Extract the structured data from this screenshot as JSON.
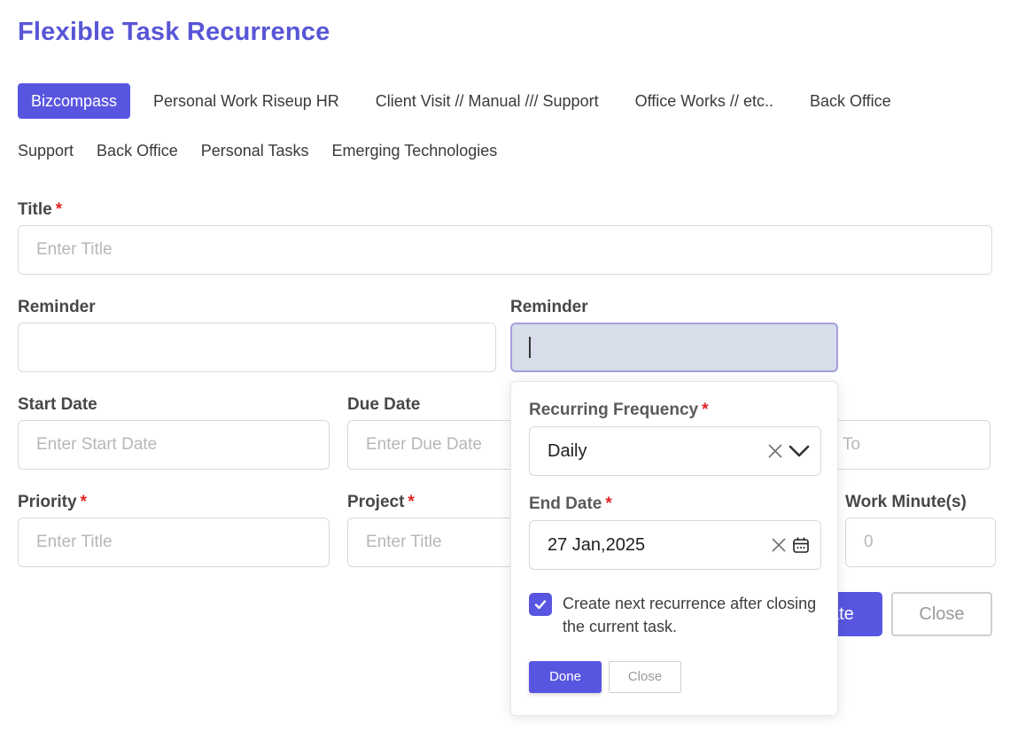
{
  "page": {
    "title": "Flexible Task Recurrence"
  },
  "tabs": {
    "row1": [
      {
        "label": "Bizcompass",
        "active": true
      },
      {
        "label": "Personal Work Riseup HR"
      },
      {
        "label": "Client Visit // Manual /// Support"
      },
      {
        "label": "Office Works // etc.."
      },
      {
        "label": "Back Office"
      }
    ],
    "row2": [
      {
        "label": "Support"
      },
      {
        "label": "Back Office"
      },
      {
        "label": "Personal Tasks"
      },
      {
        "label": "Emerging Technologies"
      }
    ]
  },
  "form": {
    "title": {
      "label": "Title",
      "required": "*",
      "placeholder": "Enter Title",
      "value": ""
    },
    "reminder_left": {
      "label": "Reminder",
      "value": ""
    },
    "reminder_right": {
      "label": "Reminder",
      "value": ""
    },
    "start_date": {
      "label": "Start Date",
      "placeholder": "Enter Start Date"
    },
    "due_date": {
      "label": "Due Date",
      "placeholder": "Enter Due Date"
    },
    "assign_to": {
      "placeholder_visible": "To"
    },
    "priority": {
      "label": "Priority",
      "required": "*",
      "placeholder": "Enter Title"
    },
    "project": {
      "label": "Project",
      "required": "*",
      "placeholder": "Enter Title"
    },
    "work_minutes": {
      "label": "Work Minute(s)",
      "placeholder": "0"
    },
    "update_button_visible": "ate",
    "close_button": "Close"
  },
  "popover": {
    "frequency": {
      "label": "Recurring Frequency",
      "required": "*",
      "value": "Daily"
    },
    "end_date": {
      "label": "End Date",
      "required": "*",
      "value": "27 Jan,2025"
    },
    "checkbox": {
      "checked": true,
      "label": "Create next recurrence after closing the current task."
    },
    "done_button": "Done",
    "close_button": "Close"
  },
  "colors": {
    "accent": "#5856e0",
    "title": "#5856d6",
    "required": "#e02424",
    "focus_bg": "#d7dde9"
  }
}
